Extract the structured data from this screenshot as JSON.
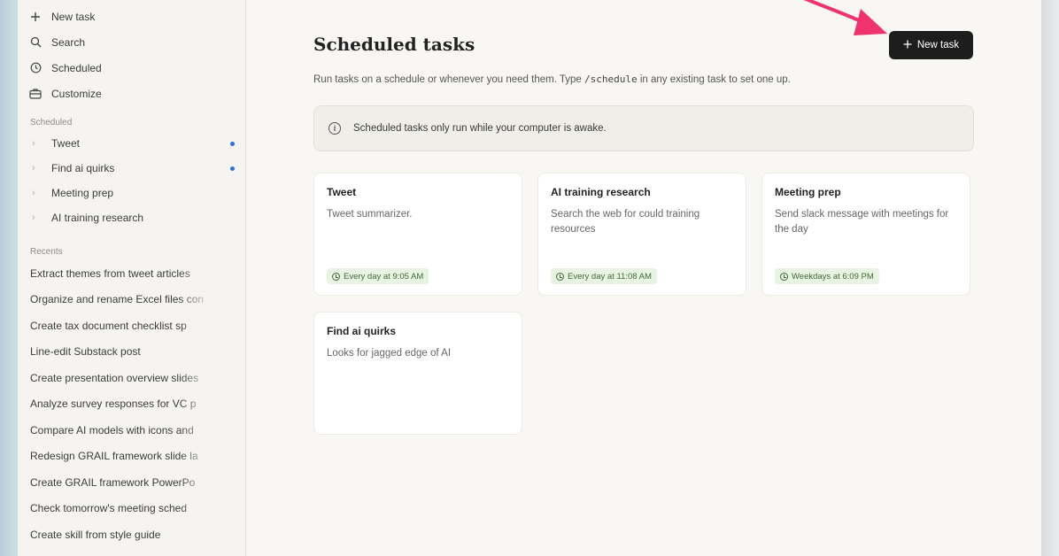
{
  "sidebar": {
    "nav": [
      {
        "label": "New task",
        "icon": "plus-icon"
      },
      {
        "label": "Search",
        "icon": "search-icon"
      },
      {
        "label": "Scheduled",
        "icon": "clock-icon"
      },
      {
        "label": "Customize",
        "icon": "briefcase-icon"
      }
    ],
    "scheduled_label": "Scheduled",
    "scheduled_items": [
      {
        "label": "Tweet",
        "dot": true
      },
      {
        "label": "Find ai quirks",
        "dot": true
      },
      {
        "label": "Meeting prep",
        "dot": false
      },
      {
        "label": "AI training research",
        "dot": false
      }
    ],
    "recents_label": "Recents",
    "recents": [
      "Extract themes from tweet articles",
      "Organize and rename Excel files con",
      "Create tax document checklist sp",
      "Line-edit Substack post",
      "Create presentation overview slides",
      "Analyze survey responses for VC p",
      "Compare AI models with icons and",
      "Redesign GRAIL framework slide la",
      "Create GRAIL framework PowerPo",
      "Check tomorrow's meeting sched",
      "Create skill from style guide"
    ]
  },
  "main": {
    "title": "Scheduled tasks",
    "new_task_label": "New task",
    "subtitle_before": "Run tasks on a schedule or whenever you need them. Type",
    "subtitle_code": "/schedule",
    "subtitle_after": "in any existing task to set one up.",
    "notice": "Scheduled tasks only run while your computer is awake.",
    "cards": [
      {
        "title": "Tweet",
        "description": "Tweet summarizer.",
        "schedule": "Every day at 9:05 AM"
      },
      {
        "title": "AI training research",
        "description": "Search the web for could training resources",
        "schedule": "Every day at 11:08 AM"
      },
      {
        "title": "Meeting prep",
        "description": "Send slack message with meetings for the day",
        "schedule": "Weekdays at 6:09 PM"
      },
      {
        "title": "Find ai quirks",
        "description": "Looks for jagged edge of AI",
        "schedule": ""
      }
    ]
  },
  "colors": {
    "accent_arrow": "#f0336e",
    "button_bg": "#1d1d1d",
    "badge_bg": "#e8f3e4",
    "badge_text": "#3f6b35",
    "unread_dot": "#2f6fd6"
  }
}
